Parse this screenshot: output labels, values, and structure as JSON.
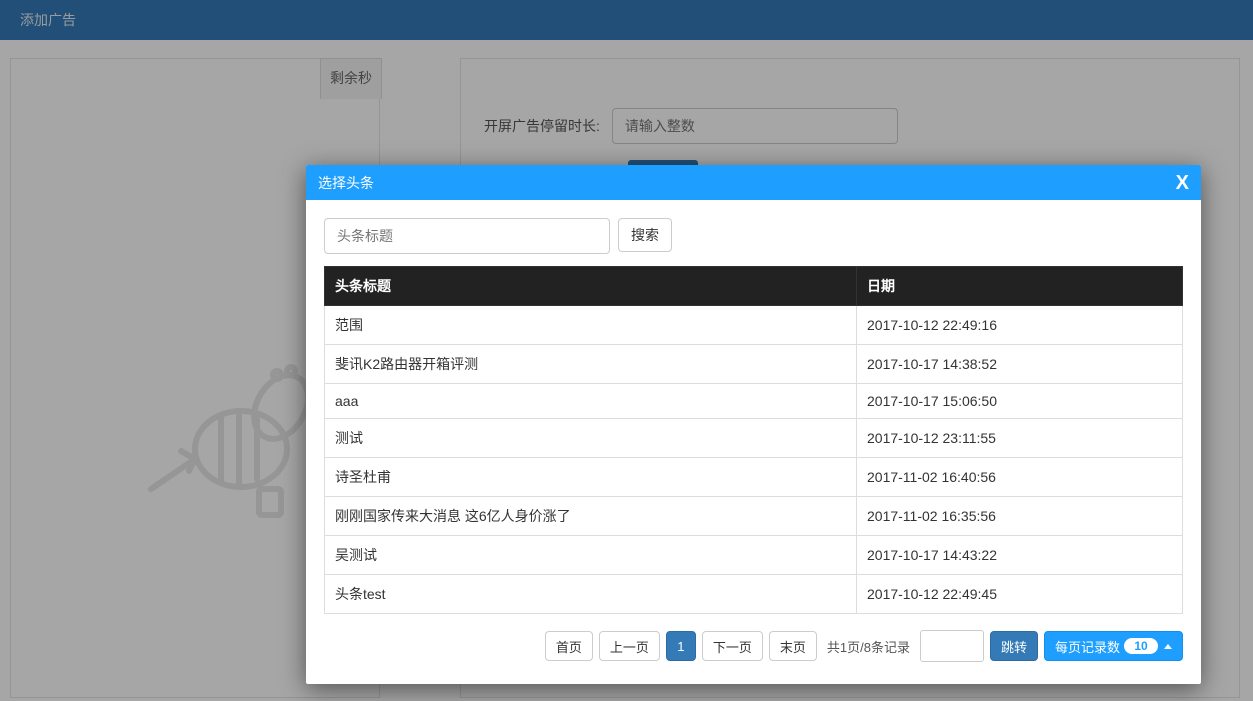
{
  "bg": {
    "title": "添加广告",
    "tab_label": "剩余秒",
    "form_label": "开屏广告停留时长:",
    "form_placeholder": "请输入整数"
  },
  "modal": {
    "title": "选择头条",
    "close": "X",
    "search_placeholder": "头条标题",
    "search_btn": "搜索",
    "columns": {
      "title": "头条标题",
      "date": "日期"
    },
    "rows": [
      {
        "title": "范围",
        "date": "2017-10-12 22:49:16"
      },
      {
        "title": "斐讯K2路由器开箱评测",
        "date": "2017-10-17 14:38:52"
      },
      {
        "title": "aaa",
        "date": "2017-10-17 15:06:50"
      },
      {
        "title": "测试",
        "date": "2017-10-12 23:11:55"
      },
      {
        "title": "诗圣杜甫",
        "date": "2017-11-02 16:40:56"
      },
      {
        "title": "刚刚国家传来大消息 这6亿人身价涨了",
        "date": "2017-11-02 16:35:56"
      },
      {
        "title": "吴测试",
        "date": "2017-10-17 14:43:22"
      },
      {
        "title": "头条test",
        "date": "2017-10-12 22:49:45"
      }
    ],
    "pager": {
      "first": "首页",
      "prev": "上一页",
      "current": "1",
      "next": "下一页",
      "last": "末页",
      "summary": "共1页/8条记录",
      "jump": "跳转",
      "pagesize_label": "每页记录数",
      "pagesize_value": "10"
    }
  }
}
